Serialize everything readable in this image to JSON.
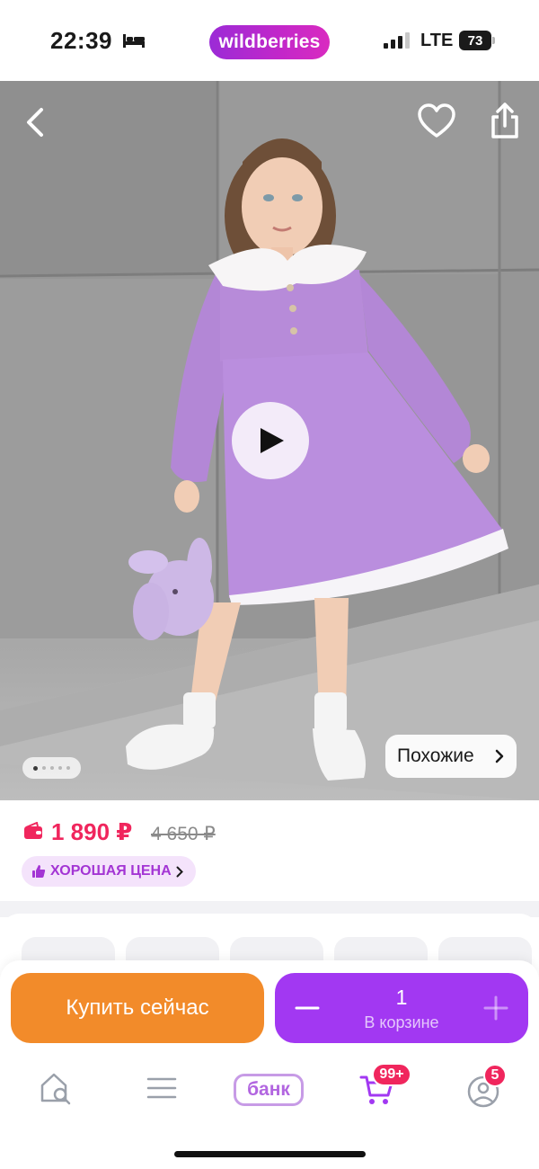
{
  "status_bar": {
    "time": "22:39",
    "sleep_icon": "bed-icon",
    "brand": "wildberries",
    "network": "LTE",
    "battery": "73",
    "brand_color": "#b12ad0"
  },
  "product": {
    "nav_icons": [
      "back-arrow-icon",
      "heart-icon",
      "share-icon"
    ],
    "play_icon": "play-icon",
    "gallery_count": 5,
    "gallery_active": 1,
    "similar_label": "Похожие"
  },
  "price": {
    "current": "1 890 ₽",
    "old": "4 650 ₽",
    "badge_label": "ХОРОШАЯ ЦЕНА",
    "accent_color": "#f0265d",
    "badge_color": "#a335d4"
  },
  "actions": {
    "buy_now_label": "Купить сейчас",
    "quantity": "1",
    "in_cart_label": "В корзине",
    "buy_color": "#f28b2a",
    "cart_color": "#a238f2"
  },
  "tab_bar": {
    "home_icon": "home-search-icon",
    "catalog_icon": "menu-icon",
    "bank_label": "банк",
    "cart_icon": "cart-icon",
    "cart_badge": "99+",
    "profile_icon": "profile-icon",
    "profile_badge": "5"
  }
}
